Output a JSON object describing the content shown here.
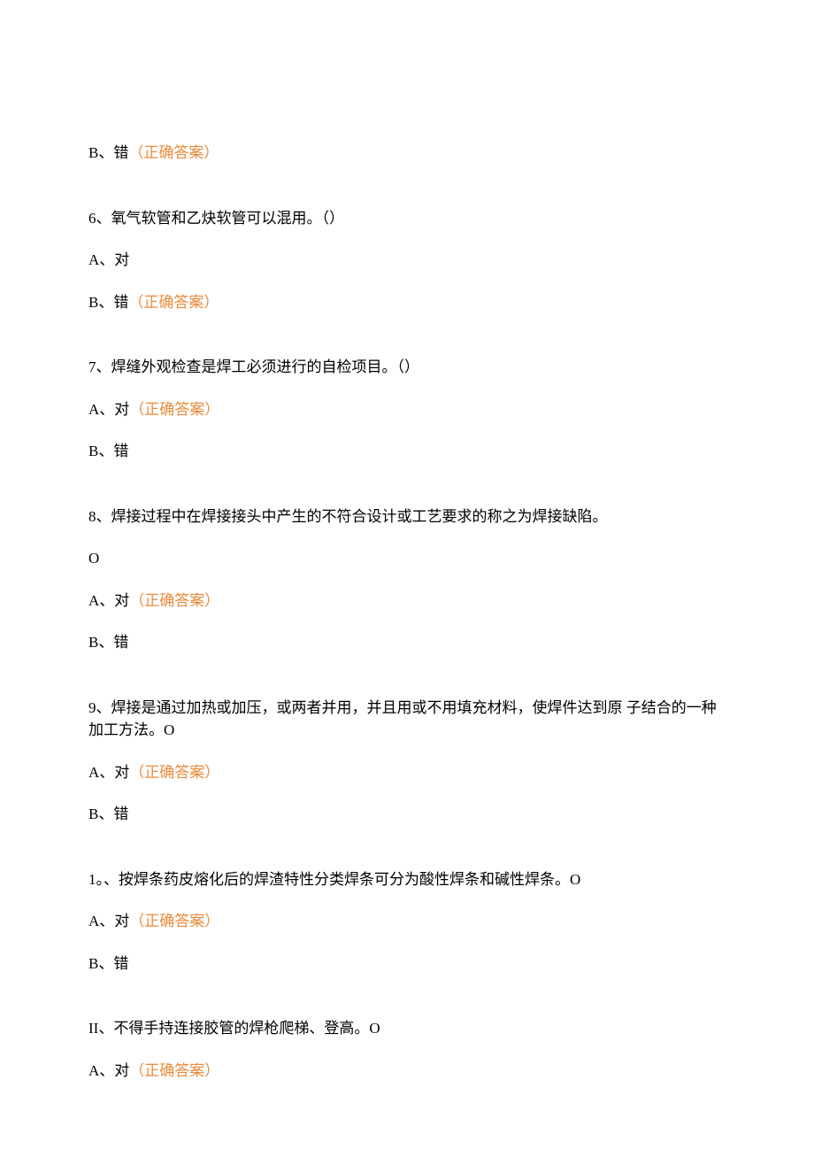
{
  "items": {
    "line1": {
      "prefix": "B、错",
      "correct_label": "（正确答案）"
    },
    "q6": {
      "question": "6、氧气软管和乙炔软管可以混用。（）",
      "optA": "A、对",
      "optB_prefix": "B、错",
      "correct_label": "（正确答案）"
    },
    "q7": {
      "question": "7、焊缝外观检查是焊工必须进行的自检项目。（）",
      "optA_prefix": "A、对",
      "correct_label": "（正确答案）",
      "optB": "B、错"
    },
    "q8": {
      "question_line1": "8、焊接过程中在焊接接头中产生的不符合设计或工艺要求的称之为焊接缺陷。",
      "question_line2": "O",
      "optA_prefix": "A、对",
      "correct_label": "（正确答案）",
      "optB": "B、错"
    },
    "q9": {
      "question_line1": "9、焊接是通过加热或加压，或两者并用，并且用或不用填充材料，使焊件达到原 子结合的一种加工方法。O",
      "optA_prefix": "A、对",
      "correct_label": "（正确答案）",
      "optB": "B、错"
    },
    "q10": {
      "question": "1。、按焊条药皮熔化后的焊渣特性分类焊条可分为酸性焊条和碱性焊条。O",
      "optA_prefix": "A、对",
      "correct_label": "（正确答案）",
      "optB": "B、错"
    },
    "q11": {
      "question": "II、不得手持连接胶管的焊枪爬梯、登高。O",
      "optA_prefix": "A、对",
      "correct_label": "（正确答案）"
    }
  }
}
